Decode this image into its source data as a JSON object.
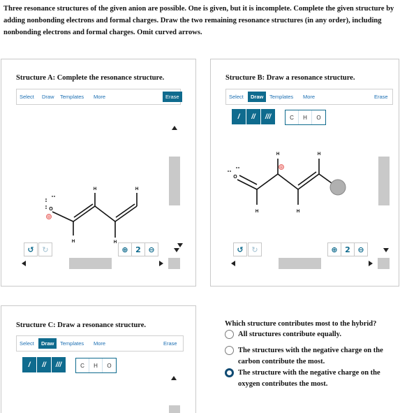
{
  "question": {
    "text": "Three resonance structures of the given anion are possible. One is given, but it is incomplete. Complete the given structure by adding nonbonding electrons and formal charges. Draw the two remaining resonance structures (in any order), including nonbonding electrons and formal charges. Omit curved arrows."
  },
  "structure_a": {
    "title": "Structure A: Complete the resonance structure.",
    "toolbar": {
      "select": "Select",
      "draw": "Draw",
      "templates": "Templates",
      "more": "More"
    },
    "erase": "Erase",
    "atoms": {
      "o": "O",
      "h1": "H",
      "h2": "H",
      "h3": "H",
      "h4": "H"
    },
    "charge": "-",
    "undo": "↺",
    "redo": "↻",
    "zoom": {
      "in": "⊕",
      "reset": "2",
      "out": "⊖"
    }
  },
  "structure_b": {
    "title": "Structure B: Draw a resonance structure.",
    "toolbar": {
      "select": "Select",
      "draw": "Draw",
      "templates": "Templates",
      "more": "More"
    },
    "erase": "Erase",
    "bonds": [
      "/",
      "//",
      "///"
    ],
    "atom_buttons": [
      "C",
      "H",
      "O"
    ],
    "atoms": {
      "o": "O",
      "h1": "H",
      "h2": "H",
      "h3": "H",
      "h4": "H"
    },
    "charge": "-",
    "undo": "↺",
    "redo": "↻",
    "zoom": {
      "in": "⊕",
      "reset": "2",
      "out": "⊖"
    }
  },
  "structure_c": {
    "title": "Structure C: Draw a resonance structure.",
    "toolbar": {
      "select": "Select",
      "draw": "Draw",
      "templates": "Templates",
      "more": "More"
    },
    "erase": "Erase",
    "bonds": [
      "/",
      "//",
      "///"
    ],
    "atom_buttons": [
      "C",
      "H",
      "O"
    ]
  },
  "hybrid": {
    "question": "Which structure contributes most to the hybrid?",
    "options": [
      {
        "label": "All structures contribute equally.",
        "selected": false
      },
      {
        "label": "The structures with the negative charge on the carbon contribute the most.",
        "selected": false
      },
      {
        "label": "The structure with the negative charge on the oxygen contributes the most.",
        "selected": true
      }
    ]
  },
  "colors": {
    "accent": "#0f6b8e",
    "link": "#1c6fb3",
    "charge": "#e0403c",
    "selected_radio": "#0f4a72"
  }
}
